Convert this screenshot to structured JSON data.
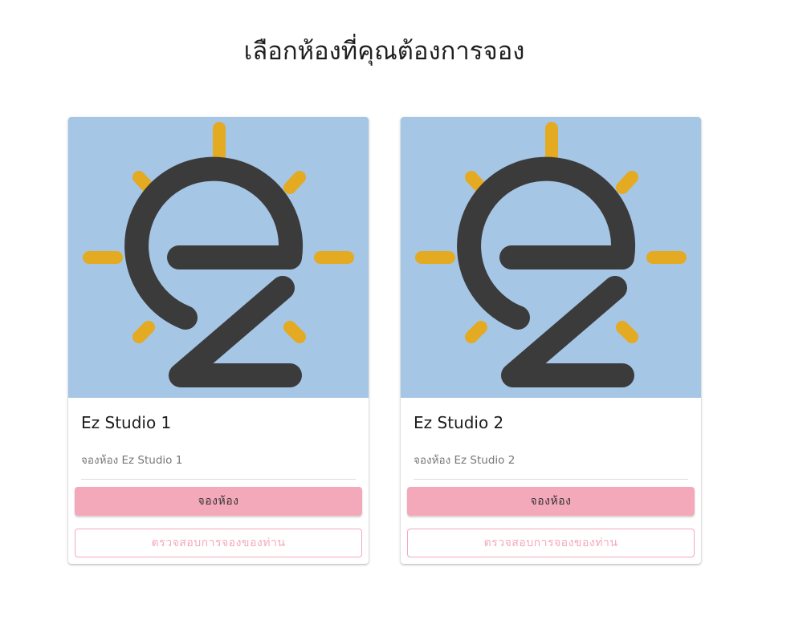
{
  "header": {
    "title": "เลือกห้องที่คุณต้องการจอง"
  },
  "brand": {
    "logo_text": "ez",
    "colors": {
      "background": "#a6c6e6",
      "sun_rays": "#e3aa22",
      "letters": "#3b3b3b",
      "book_button": "#f4a9bb",
      "check_button_border": "#f4a9bb"
    }
  },
  "rooms": [
    {
      "name": "Ez Studio 1",
      "description": "จองห้อง Ez Studio 1",
      "book_label": "จองห้อง",
      "check_label": "ตรวจสอบการจองของท่าน"
    },
    {
      "name": "Ez Studio 2",
      "description": "จองห้อง Ez Studio 2",
      "book_label": "จองห้อง",
      "check_label": "ตรวจสอบการจองของท่าน"
    }
  ]
}
